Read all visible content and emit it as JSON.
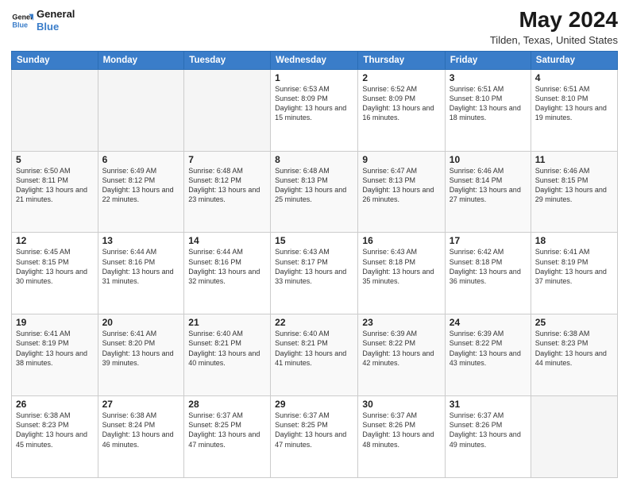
{
  "header": {
    "logo_line1": "General",
    "logo_line2": "Blue",
    "month": "May 2024",
    "location": "Tilden, Texas, United States"
  },
  "weekdays": [
    "Sunday",
    "Monday",
    "Tuesday",
    "Wednesday",
    "Thursday",
    "Friday",
    "Saturday"
  ],
  "weeks": [
    [
      {
        "day": "",
        "info": ""
      },
      {
        "day": "",
        "info": ""
      },
      {
        "day": "",
        "info": ""
      },
      {
        "day": "1",
        "info": "Sunrise: 6:53 AM\nSunset: 8:09 PM\nDaylight: 13 hours and 15 minutes."
      },
      {
        "day": "2",
        "info": "Sunrise: 6:52 AM\nSunset: 8:09 PM\nDaylight: 13 hours and 16 minutes."
      },
      {
        "day": "3",
        "info": "Sunrise: 6:51 AM\nSunset: 8:10 PM\nDaylight: 13 hours and 18 minutes."
      },
      {
        "day": "4",
        "info": "Sunrise: 6:51 AM\nSunset: 8:10 PM\nDaylight: 13 hours and 19 minutes."
      }
    ],
    [
      {
        "day": "5",
        "info": "Sunrise: 6:50 AM\nSunset: 8:11 PM\nDaylight: 13 hours and 21 minutes."
      },
      {
        "day": "6",
        "info": "Sunrise: 6:49 AM\nSunset: 8:12 PM\nDaylight: 13 hours and 22 minutes."
      },
      {
        "day": "7",
        "info": "Sunrise: 6:48 AM\nSunset: 8:12 PM\nDaylight: 13 hours and 23 minutes."
      },
      {
        "day": "8",
        "info": "Sunrise: 6:48 AM\nSunset: 8:13 PM\nDaylight: 13 hours and 25 minutes."
      },
      {
        "day": "9",
        "info": "Sunrise: 6:47 AM\nSunset: 8:13 PM\nDaylight: 13 hours and 26 minutes."
      },
      {
        "day": "10",
        "info": "Sunrise: 6:46 AM\nSunset: 8:14 PM\nDaylight: 13 hours and 27 minutes."
      },
      {
        "day": "11",
        "info": "Sunrise: 6:46 AM\nSunset: 8:15 PM\nDaylight: 13 hours and 29 minutes."
      }
    ],
    [
      {
        "day": "12",
        "info": "Sunrise: 6:45 AM\nSunset: 8:15 PM\nDaylight: 13 hours and 30 minutes."
      },
      {
        "day": "13",
        "info": "Sunrise: 6:44 AM\nSunset: 8:16 PM\nDaylight: 13 hours and 31 minutes."
      },
      {
        "day": "14",
        "info": "Sunrise: 6:44 AM\nSunset: 8:16 PM\nDaylight: 13 hours and 32 minutes."
      },
      {
        "day": "15",
        "info": "Sunrise: 6:43 AM\nSunset: 8:17 PM\nDaylight: 13 hours and 33 minutes."
      },
      {
        "day": "16",
        "info": "Sunrise: 6:43 AM\nSunset: 8:18 PM\nDaylight: 13 hours and 35 minutes."
      },
      {
        "day": "17",
        "info": "Sunrise: 6:42 AM\nSunset: 8:18 PM\nDaylight: 13 hours and 36 minutes."
      },
      {
        "day": "18",
        "info": "Sunrise: 6:41 AM\nSunset: 8:19 PM\nDaylight: 13 hours and 37 minutes."
      }
    ],
    [
      {
        "day": "19",
        "info": "Sunrise: 6:41 AM\nSunset: 8:19 PM\nDaylight: 13 hours and 38 minutes."
      },
      {
        "day": "20",
        "info": "Sunrise: 6:41 AM\nSunset: 8:20 PM\nDaylight: 13 hours and 39 minutes."
      },
      {
        "day": "21",
        "info": "Sunrise: 6:40 AM\nSunset: 8:21 PM\nDaylight: 13 hours and 40 minutes."
      },
      {
        "day": "22",
        "info": "Sunrise: 6:40 AM\nSunset: 8:21 PM\nDaylight: 13 hours and 41 minutes."
      },
      {
        "day": "23",
        "info": "Sunrise: 6:39 AM\nSunset: 8:22 PM\nDaylight: 13 hours and 42 minutes."
      },
      {
        "day": "24",
        "info": "Sunrise: 6:39 AM\nSunset: 8:22 PM\nDaylight: 13 hours and 43 minutes."
      },
      {
        "day": "25",
        "info": "Sunrise: 6:38 AM\nSunset: 8:23 PM\nDaylight: 13 hours and 44 minutes."
      }
    ],
    [
      {
        "day": "26",
        "info": "Sunrise: 6:38 AM\nSunset: 8:23 PM\nDaylight: 13 hours and 45 minutes."
      },
      {
        "day": "27",
        "info": "Sunrise: 6:38 AM\nSunset: 8:24 PM\nDaylight: 13 hours and 46 minutes."
      },
      {
        "day": "28",
        "info": "Sunrise: 6:37 AM\nSunset: 8:25 PM\nDaylight: 13 hours and 47 minutes."
      },
      {
        "day": "29",
        "info": "Sunrise: 6:37 AM\nSunset: 8:25 PM\nDaylight: 13 hours and 47 minutes."
      },
      {
        "day": "30",
        "info": "Sunrise: 6:37 AM\nSunset: 8:26 PM\nDaylight: 13 hours and 48 minutes."
      },
      {
        "day": "31",
        "info": "Sunrise: 6:37 AM\nSunset: 8:26 PM\nDaylight: 13 hours and 49 minutes."
      },
      {
        "day": "",
        "info": ""
      }
    ]
  ]
}
